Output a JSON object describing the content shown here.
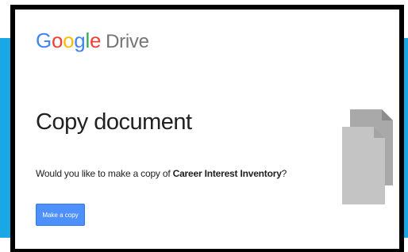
{
  "logo": {
    "letters": [
      "G",
      "o",
      "o",
      "g",
      "l",
      "e"
    ],
    "product": "Drive"
  },
  "page": {
    "title": "Copy document",
    "prompt_prefix": "Would you like to make a copy of ",
    "document_name": "Career Interest Inventory",
    "prompt_suffix": "?"
  },
  "actions": {
    "make_copy_label": "Make a copy"
  },
  "colors": {
    "brand_blue": "#4285f4",
    "brand_red": "#ea4335",
    "brand_yellow": "#fbbc05",
    "brand_green": "#34a853",
    "button_blue": "#4d90fe",
    "background_band": "#1aa7e6",
    "frame": "#000000",
    "doc_icon": "#bdbdbd"
  },
  "icons": {
    "documents": "copy-documents-icon"
  }
}
